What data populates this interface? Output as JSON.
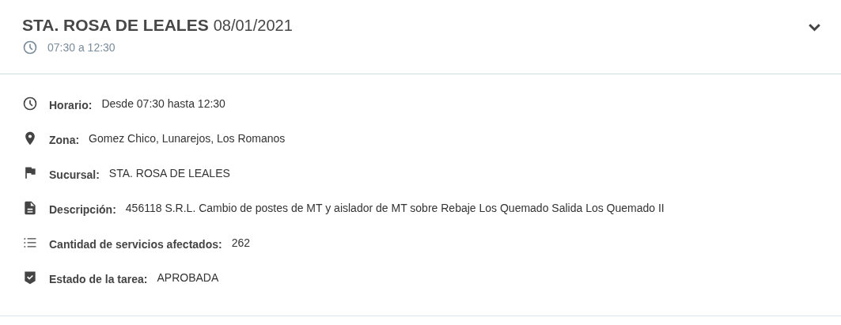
{
  "header": {
    "title": "STA. ROSA DE LEALES",
    "date": "08/01/2021",
    "time_range": "07:30 a 12:30",
    "expanded": true
  },
  "details": [
    {
      "kind": "clock",
      "label": "Horario:",
      "value": "Desde 07:30 hasta 12:30"
    },
    {
      "kind": "pin",
      "label": "Zona:",
      "value": "Gomez Chico, Lunarejos, Los Romanos"
    },
    {
      "kind": "flag",
      "label": "Sucursal:",
      "value": "STA. ROSA DE LEALES"
    },
    {
      "kind": "document",
      "label": "Descripción:",
      "value": "456118 S.R.L. Cambio de postes de MT y aislador de MT sobre Rebaje Los Quemado Salida Los Quemado II"
    },
    {
      "kind": "list",
      "label": "Cantidad de servicios afectados:",
      "value": "262"
    },
    {
      "kind": "shield",
      "label": "Estado de la tarea:",
      "value": "APROBADA"
    }
  ]
}
